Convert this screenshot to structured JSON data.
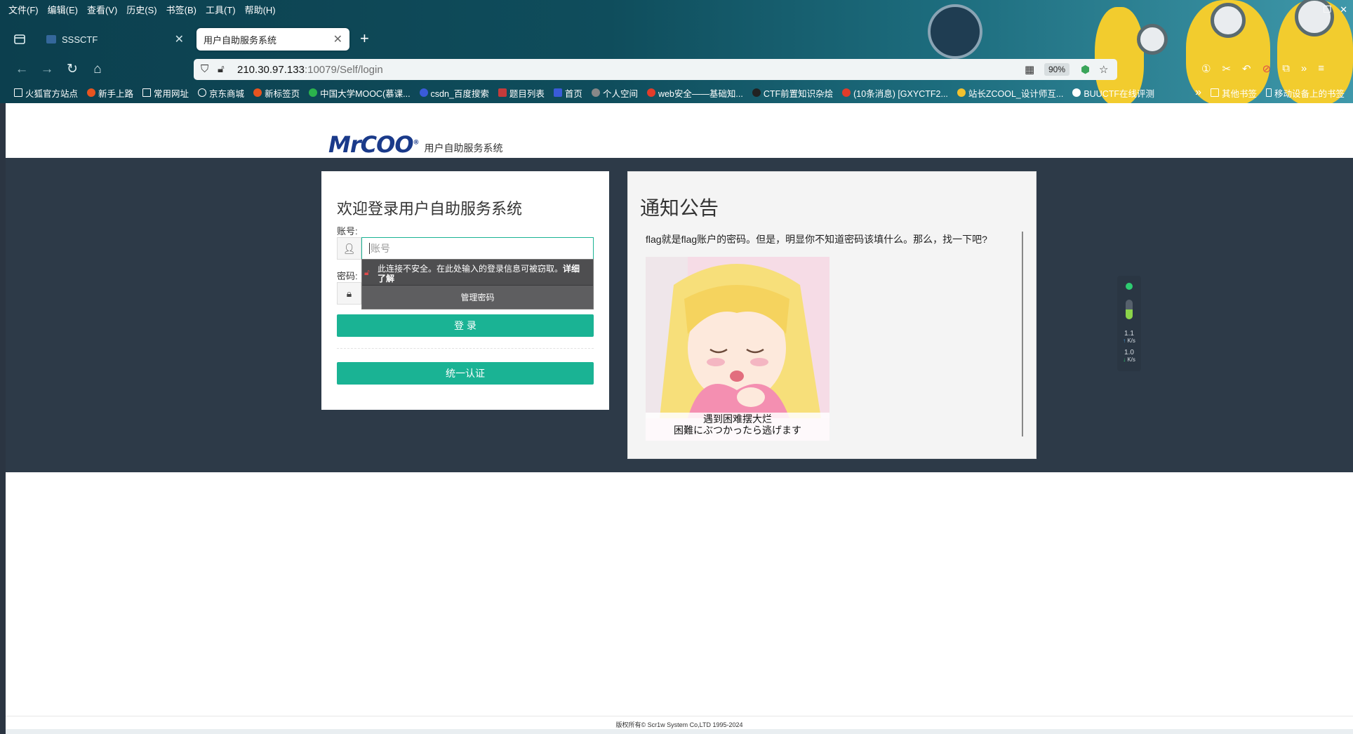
{
  "browser": {
    "menu": [
      "文件(F)",
      "编辑(E)",
      "查看(V)",
      "历史(S)",
      "书签(B)",
      "工具(T)",
      "帮助(H)"
    ],
    "tabs": [
      {
        "title": "SSSCTF",
        "close": "✕",
        "active": false
      },
      {
        "title": "用户自助服务系统",
        "close": "✕",
        "active": true
      }
    ],
    "new_tab": "+",
    "url": {
      "host": "210.30.97.133",
      "path": ":10079/Self/login"
    },
    "zoom": "90%",
    "bookmarks": [
      {
        "label": "火狐官方站点",
        "color": "#ffffff"
      },
      {
        "label": "新手上路",
        "color": "#e8541f"
      },
      {
        "label": "常用网址",
        "color": "#ffffff"
      },
      {
        "label": "京东商城",
        "color": "#ffffff"
      },
      {
        "label": "新标签页",
        "color": "#e8541f"
      },
      {
        "label": "中国大学MOOC(慕课...",
        "color": "#2bb24c"
      },
      {
        "label": "csdn_百度搜索",
        "color": "#3a5bd9"
      },
      {
        "label": "题目列表",
        "color": "#c43b3b"
      },
      {
        "label": "首页",
        "color": "#3a5bd9"
      },
      {
        "label": "个人空间",
        "color": "#888888"
      },
      {
        "label": "web安全——基础知...",
        "color": "#e23c2a"
      },
      {
        "label": "CTF前置知识杂烩",
        "color": "#222222"
      },
      {
        "label": "(10条消息) [GXYCTF2...",
        "color": "#e23c2a"
      },
      {
        "label": "站长ZCOOL_设计师互...",
        "color": "#f2c12e"
      },
      {
        "label": "BUUCTF在线评测",
        "color": "#ffffff"
      }
    ],
    "bookmarks_overflow": "»",
    "other_bookmarks": "其他书签",
    "mobile_bookmarks": "移动设备上的书签"
  },
  "page": {
    "logo_text": "MrCOO",
    "brand_subtitle": "用户自助服务系统",
    "login": {
      "title": "欢迎登录用户自助服务系统",
      "account_label": "账号:",
      "account_placeholder": "账号",
      "password_label": "密码:",
      "login_button": "登 录",
      "sso_button": "统一认证"
    },
    "password_popup": {
      "warning": "此连接不安全。在此处输入的登录信息可被窃取。",
      "learn_more": "详细了解",
      "manage": "管理密码"
    },
    "notice": {
      "title": "通知公告",
      "text": "flag就是flag账户的密码。但是，明显你不知道密码该填什么。那么，找一下吧?",
      "image_caption_1": "遇到困难摆大烂",
      "image_caption_2": "困難にぶつかったら逃げます"
    },
    "net_widget": {
      "up": "1.1",
      "up_unit": "K/s",
      "down": "1.0",
      "down_unit": "K/s"
    },
    "footer": "版权所有© Scr1w System Co,LTD 1995-2024"
  }
}
